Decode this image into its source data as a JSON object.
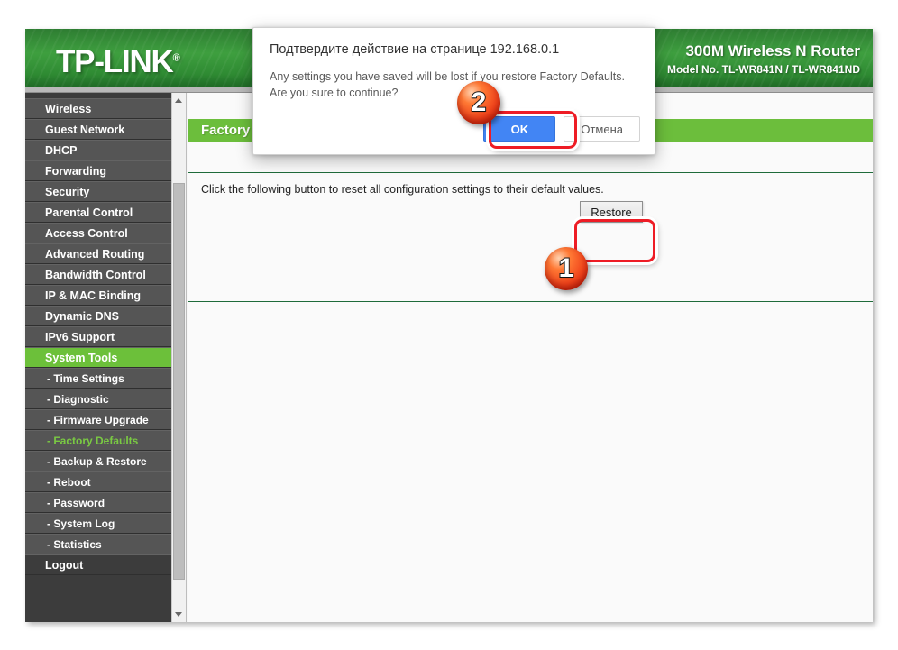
{
  "header": {
    "logo": "TP-LINK",
    "logo_mark": "®",
    "model_name": "300M Wireless N Router",
    "model_no": "Model No. TL-WR841N / TL-WR841ND"
  },
  "sidebar": {
    "items": [
      {
        "label": "Wireless",
        "type": "main",
        "state": "normal"
      },
      {
        "label": "Guest Network",
        "type": "main",
        "state": "normal"
      },
      {
        "label": "DHCP",
        "type": "main",
        "state": "normal"
      },
      {
        "label": "Forwarding",
        "type": "main",
        "state": "normal"
      },
      {
        "label": "Security",
        "type": "main",
        "state": "normal"
      },
      {
        "label": "Parental Control",
        "type": "main",
        "state": "normal"
      },
      {
        "label": "Access Control",
        "type": "main",
        "state": "normal"
      },
      {
        "label": "Advanced Routing",
        "type": "main",
        "state": "normal"
      },
      {
        "label": "Bandwidth Control",
        "type": "main",
        "state": "normal"
      },
      {
        "label": "IP & MAC Binding",
        "type": "main",
        "state": "normal"
      },
      {
        "label": "Dynamic DNS",
        "type": "main",
        "state": "normal"
      },
      {
        "label": "IPv6 Support",
        "type": "main",
        "state": "normal"
      },
      {
        "label": "System Tools",
        "type": "main",
        "state": "active"
      },
      {
        "label": "- Time Settings",
        "type": "sub",
        "state": "normal"
      },
      {
        "label": "- Diagnostic",
        "type": "sub",
        "state": "normal"
      },
      {
        "label": "- Firmware Upgrade",
        "type": "sub",
        "state": "normal"
      },
      {
        "label": "- Factory Defaults",
        "type": "sub",
        "state": "sub-active"
      },
      {
        "label": "- Backup & Restore",
        "type": "sub",
        "state": "normal"
      },
      {
        "label": "- Reboot",
        "type": "sub",
        "state": "normal"
      },
      {
        "label": "- Password",
        "type": "sub",
        "state": "normal"
      },
      {
        "label": "- System Log",
        "type": "sub",
        "state": "normal"
      },
      {
        "label": "- Statistics",
        "type": "sub",
        "state": "normal"
      },
      {
        "label": "Logout",
        "type": "logout",
        "state": "normal"
      }
    ]
  },
  "content": {
    "section_title": "Factory Defaults",
    "description": "Click the following button to reset all configuration settings to their default values.",
    "restore_button": "Restore"
  },
  "dialog": {
    "title": "Подтвердите действие на странице 192.168.0.1",
    "message": "Any settings you have saved will be lost if you restore Factory Defaults. Are you sure to continue?",
    "ok_label": "OK",
    "cancel_label": "Отмена"
  },
  "annotations": {
    "step_one": "1",
    "step_two": "2",
    "highlight_color": "#ee1c25",
    "badge_color": "#f0441b",
    "accent_green": "#6cbe3c",
    "primary_blue": "#4285f4"
  }
}
